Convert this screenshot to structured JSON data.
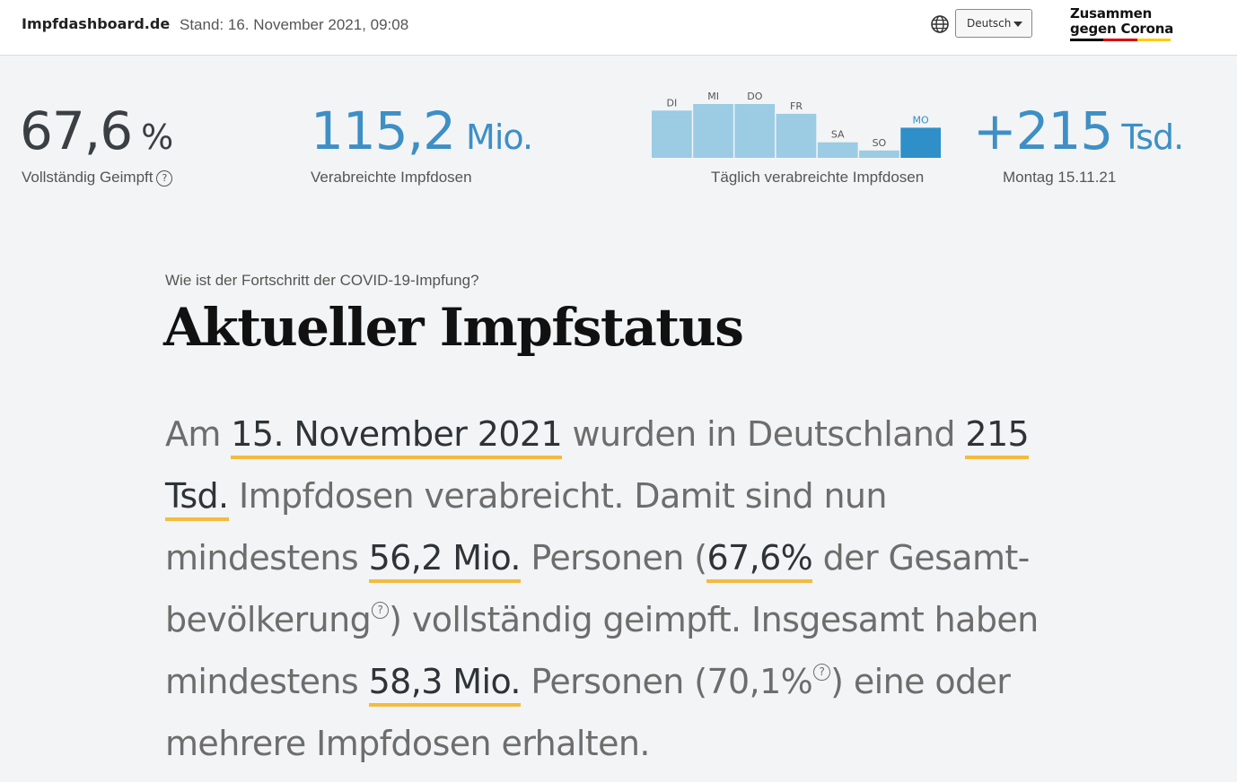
{
  "header": {
    "brand": "Impfdashboard.de",
    "stand": "Stand: 16. November 2021, 09:08",
    "language": "Deutsch",
    "logo_line1": "Zusammen",
    "logo_line2": "gegen Corona",
    "logo_colors": [
      "#000000",
      "#dd0000",
      "#ffcc00"
    ]
  },
  "stats": {
    "fully_vaccinated": {
      "value": "67,6",
      "unit": "%",
      "label": "Vollständig Geimpft",
      "help": "?"
    },
    "doses_total": {
      "value": "115,2",
      "unit": "Mio.",
      "label": "Verabreichte Impfdosen"
    },
    "daily_chart_label": "Täglich verabreichte Impfdosen",
    "daily": {
      "value": "+215",
      "unit": "Tsd.",
      "label": "Montag 15.11.21"
    }
  },
  "chart_data": {
    "type": "bar",
    "categories": [
      "DI",
      "MI",
      "DO",
      "FR",
      "SA",
      "SO",
      "MO"
    ],
    "values": [
      0.58,
      0.66,
      0.66,
      0.54,
      0.19,
      0.09,
      0.37
    ],
    "highlight_index": 6,
    "xlabel": "",
    "ylabel": "",
    "colors": {
      "bar": "#9ccbe4",
      "highlight": "#2f8fc8",
      "label": "#555555",
      "highlight_label": "#2f8fc8"
    }
  },
  "article": {
    "kicker": "Wie ist der Fortschritt der COVID-19-Impfung?",
    "title": "Aktueller Impfstatus",
    "t1": "Am ",
    "h1": "15. November 2021",
    "t2": " wurden in Deutschland ",
    "h2": "215 Tsd.",
    "t3": " Impfdosen verabreicht. Damit sind nun mindestens ",
    "h3": "56,2 Mio.",
    "t4": " Personen (",
    "h4": "67,6%",
    "t5": " der Gesamt-bevölkerung",
    "q1": "?",
    "t6": ") vollständig geimpft. Insgesamt haben mindestens ",
    "h5": "58,3 Mio.",
    "t7": " Personen (70,1%",
    "q2": "?",
    "t8": ") eine oder mehrere Impfdosen erhalten."
  }
}
